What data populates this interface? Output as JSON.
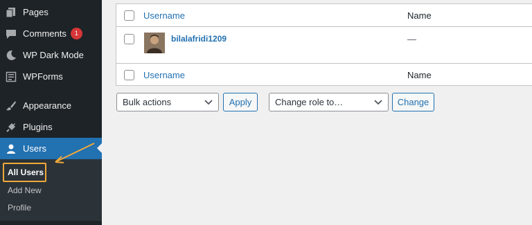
{
  "sidebar": {
    "items": [
      {
        "label": "Pages",
        "icon": "pages-icon"
      },
      {
        "label": "Comments",
        "icon": "comments-icon",
        "badge": "1"
      },
      {
        "label": "WP Dark Mode",
        "icon": "moon-icon"
      },
      {
        "label": "WPForms",
        "icon": "forms-icon"
      },
      {
        "label": "Appearance",
        "icon": "brush-icon"
      },
      {
        "label": "Plugins",
        "icon": "plugin-icon"
      },
      {
        "label": "Users",
        "icon": "user-icon",
        "active": true
      }
    ],
    "submenu": [
      {
        "label": "All Users",
        "current": true
      },
      {
        "label": "Add New"
      },
      {
        "label": "Profile"
      }
    ]
  },
  "table": {
    "header": {
      "username": "Username",
      "name": "Name"
    },
    "rows": [
      {
        "username": "bilalafridi1209",
        "name": "—"
      }
    ],
    "footer": {
      "username": "Username",
      "name": "Name"
    }
  },
  "actions": {
    "bulk_select": "Bulk actions",
    "apply_label": "Apply",
    "role_select": "Change role to…",
    "change_label": "Change"
  },
  "colors": {
    "sidebar_bg": "#1d2327",
    "active_bg": "#2271b1",
    "link": "#2271b1",
    "badge": "#d63638",
    "highlight": "#f0a93a"
  }
}
